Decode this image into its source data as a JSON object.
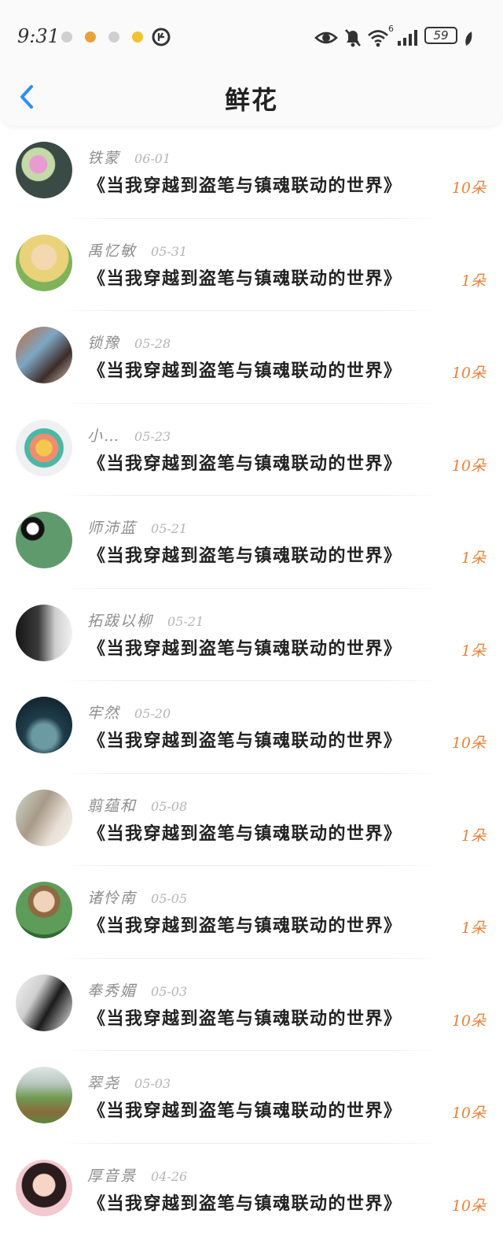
{
  "status_bar": {
    "time": "9:31",
    "battery": "59",
    "network_label": "6"
  },
  "header": {
    "title": "鲜花",
    "back_icon": "chevron-left-icon"
  },
  "colors": {
    "accent": "#2c8ef8",
    "count": "#e8823c",
    "name": "#8d8d8d",
    "date": "#b4b4b4"
  },
  "records": [
    {
      "name": "铁蒙",
      "date": "06-01",
      "book": "《当我穿越到盗笔与镇魂联动的世界》",
      "count": "10朵"
    },
    {
      "name": "禹忆敏",
      "date": "05-31",
      "book": "《当我穿越到盗笔与镇魂联动的世界》",
      "count": "1朵"
    },
    {
      "name": "锁豫",
      "date": "05-28",
      "book": "《当我穿越到盗笔与镇魂联动的世界》",
      "count": "10朵"
    },
    {
      "name": "小…",
      "date": "05-23",
      "book": "《当我穿越到盗笔与镇魂联动的世界》",
      "count": "10朵"
    },
    {
      "name": "师沛蓝",
      "date": "05-21",
      "book": "《当我穿越到盗笔与镇魂联动的世界》",
      "count": "1朵"
    },
    {
      "name": "拓跋以柳",
      "date": "05-21",
      "book": "《当我穿越到盗笔与镇魂联动的世界》",
      "count": "1朵"
    },
    {
      "name": "牢然",
      "date": "05-20",
      "book": "《当我穿越到盗笔与镇魂联动的世界》",
      "count": "10朵"
    },
    {
      "name": "翦蕴和",
      "date": "05-08",
      "book": "《当我穿越到盗笔与镇魂联动的世界》",
      "count": "1朵"
    },
    {
      "name": "诸怜南",
      "date": "05-05",
      "book": "《当我穿越到盗笔与镇魂联动的世界》",
      "count": "1朵"
    },
    {
      "name": "奉秀媚",
      "date": "05-03",
      "book": "《当我穿越到盗笔与镇魂联动的世界》",
      "count": "10朵"
    },
    {
      "name": "翠尧",
      "date": "05-03",
      "book": "《当我穿越到盗笔与镇魂联动的世界》",
      "count": "10朵"
    },
    {
      "name": "厚音景",
      "date": "04-26",
      "book": "《当我穿越到盗笔与镇魂联动的世界》",
      "count": "10朵"
    }
  ]
}
